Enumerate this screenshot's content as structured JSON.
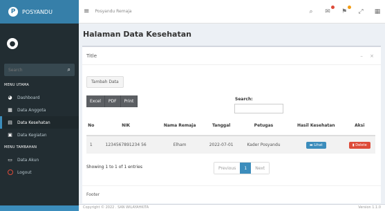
{
  "brand": {
    "name": "POSYANDU",
    "logo_letter": "P"
  },
  "sidebar": {
    "search_placeholder": "Search",
    "menu_header_1": "MENU UTAMA",
    "menu_header_2": "MENU TAMBAHAN",
    "items": [
      {
        "label": "Dashboard",
        "icon": "dashboard-icon"
      },
      {
        "label": "Data Anggota",
        "icon": "grid-icon"
      },
      {
        "label": "Data Kesehatan",
        "icon": "document-icon"
      },
      {
        "label": "Data Kegiatan",
        "icon": "calendar-icon"
      },
      {
        "label": "Data Akun",
        "icon": "id-card-icon"
      },
      {
        "label": "Logout",
        "icon": "logout-circle-icon"
      }
    ],
    "active_item": "Data Kesehatan"
  },
  "topbar": {
    "title": "Posyandu Remaja",
    "badge_colors": [
      "#dd4b39",
      "#f39c12",
      "#00a65a"
    ]
  },
  "page": {
    "title": "Halaman Data Kesehatan"
  },
  "box": {
    "title": "Title",
    "tools": "– ×",
    "add_button": "Tambah Data",
    "export_buttons": [
      "Excel",
      "PDF",
      "Print"
    ],
    "search_label": "Search:",
    "footer": "Footer"
  },
  "table": {
    "headers": [
      "No",
      "NIK",
      "Nama Remaja",
      "Tanggal",
      "Petugas",
      "Hasil Kesehatan",
      "Aksi"
    ],
    "rows": [
      {
        "no": "1",
        "nik": "1234567891234 56",
        "nama": "Elham",
        "tanggal": "2022-07-01",
        "petugas": "Kader Posyandu",
        "lihat": "Lihat",
        "delete": "Delete"
      }
    ]
  },
  "entries_text": "Showing 1 to 1 of 1 entries",
  "pagination": {
    "previous": "Previous",
    "current": "1",
    "next": "Next"
  },
  "footer": {
    "left": "Copyright © 2022 . SAN WILAYAHKITA",
    "right": "Version 1.1.0"
  },
  "colors": {
    "sidebar": "#222d32",
    "brand": "#367fa9",
    "accent": "#3c8dbc",
    "danger": "#dd4b39"
  }
}
